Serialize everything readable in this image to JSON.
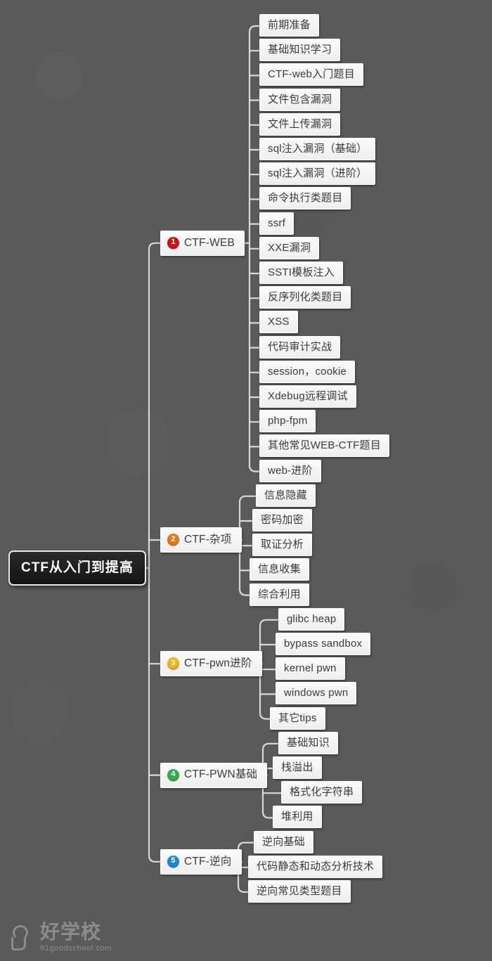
{
  "meta": {
    "title": "CTF从入门到提高 思维导图",
    "background_color": "#5a5a5a",
    "node_fill": "#f4f4f4",
    "node_text_color": "#3a3a3a",
    "connector_color": "#d8d8d8",
    "root_fill": "#1d1d1d",
    "root_text_color": "#ffffff"
  },
  "root": {
    "label": "CTF从入门到提高"
  },
  "watermark": {
    "cn": "好学校",
    "en": "91goodschool.com",
    "icon": "logo-icon"
  },
  "branches": [
    {
      "number": "1",
      "label": "CTF-WEB",
      "badge_color": "#cc1118",
      "children": [
        {
          "label": "前期准备"
        },
        {
          "label": "基础知识学习"
        },
        {
          "label": "CTF-web入门题目"
        },
        {
          "label": "文件包含漏洞"
        },
        {
          "label": "文件上传漏洞"
        },
        {
          "label": "sql注入漏洞（基础）"
        },
        {
          "label": "sql注入漏洞（进阶）"
        },
        {
          "label": "命令执行类题目"
        },
        {
          "label": "ssrf"
        },
        {
          "label": "XXE漏洞"
        },
        {
          "label": "SSTI模板注入"
        },
        {
          "label": "反序列化类题目"
        },
        {
          "label": "XSS"
        },
        {
          "label": "代码审计实战"
        },
        {
          "label": "session，cookie"
        },
        {
          "label": "Xdebug远程调试"
        },
        {
          "label": "php-fpm"
        },
        {
          "label": "其他常见WEB-CTF题目"
        },
        {
          "label": "web-进阶"
        }
      ]
    },
    {
      "number": "2",
      "label": "CTF-杂项",
      "badge_color": "#e8761a",
      "children": [
        {
          "label": "信息隐藏"
        },
        {
          "label": "密码加密"
        },
        {
          "label": "取证分析"
        },
        {
          "label": "信息收集"
        },
        {
          "label": "综合利用"
        }
      ]
    },
    {
      "number": "3",
      "label": "CTF-pwn进阶",
      "badge_color": "#f2b418",
      "children": [
        {
          "label": "glibc heap"
        },
        {
          "label": "bypass sandbox"
        },
        {
          "label": "kernel pwn"
        },
        {
          "label": "windows pwn"
        },
        {
          "label": "其它tips"
        }
      ]
    },
    {
      "number": "4",
      "label": "CTF-PWN基础",
      "badge_color": "#3aa84c",
      "children": [
        {
          "label": "基础知识"
        },
        {
          "label": "栈溢出"
        },
        {
          "label": "格式化字符串"
        },
        {
          "label": "堆利用"
        }
      ]
    },
    {
      "number": "5",
      "label": "CTF-逆向",
      "badge_color": "#1f86d8",
      "children": [
        {
          "label": "逆向基础"
        },
        {
          "label": "代码静态和动态分析技术"
        },
        {
          "label": "逆向常见类型题目"
        }
      ]
    }
  ]
}
